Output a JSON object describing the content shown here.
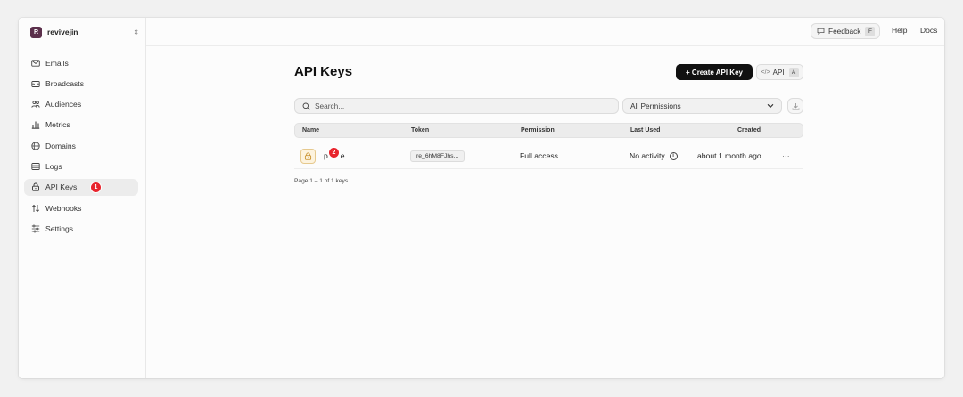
{
  "workspace": {
    "initial": "R",
    "name": "revivejin"
  },
  "sidebar": {
    "items": [
      {
        "label": "Emails",
        "icon": "mail-icon"
      },
      {
        "label": "Broadcasts",
        "icon": "broadcast-icon"
      },
      {
        "label": "Audiences",
        "icon": "users-icon"
      },
      {
        "label": "Metrics",
        "icon": "bar-chart-icon"
      },
      {
        "label": "Domains",
        "icon": "globe-icon"
      },
      {
        "label": "Logs",
        "icon": "logs-icon"
      },
      {
        "label": "API Keys",
        "icon": "lock-icon",
        "active": true,
        "badge": "1"
      },
      {
        "label": "Webhooks",
        "icon": "webhook-icon"
      },
      {
        "label": "Settings",
        "icon": "settings-icon"
      }
    ]
  },
  "topbar": {
    "feedback_label": "Feedback",
    "feedback_key": "F",
    "help_label": "Help",
    "docs_label": "Docs"
  },
  "page": {
    "title": "API Keys",
    "create_label": "+ Create API Key",
    "api_label": "API",
    "api_key": "A",
    "search_placeholder": "Search...",
    "permission_filter": "All Permissions"
  },
  "table": {
    "headers": {
      "name": "Name",
      "token": "Token",
      "permission": "Permission",
      "last_used": "Last Used",
      "created": "Created"
    },
    "rows": [
      {
        "name_start": "p",
        "name_end": "e",
        "badge": "2",
        "token": "re_6hM8FJhs...",
        "permission": "Full access",
        "last_used": "No activity",
        "created": "about 1 month ago",
        "more": "···"
      }
    ]
  },
  "pager": "Page 1 – 1 of 1 keys",
  "colors": {
    "accent": "#111111",
    "badge": "#e8242d",
    "workspace_avatar": "#5b2f4b",
    "lock_bg": "#fdf3de"
  }
}
